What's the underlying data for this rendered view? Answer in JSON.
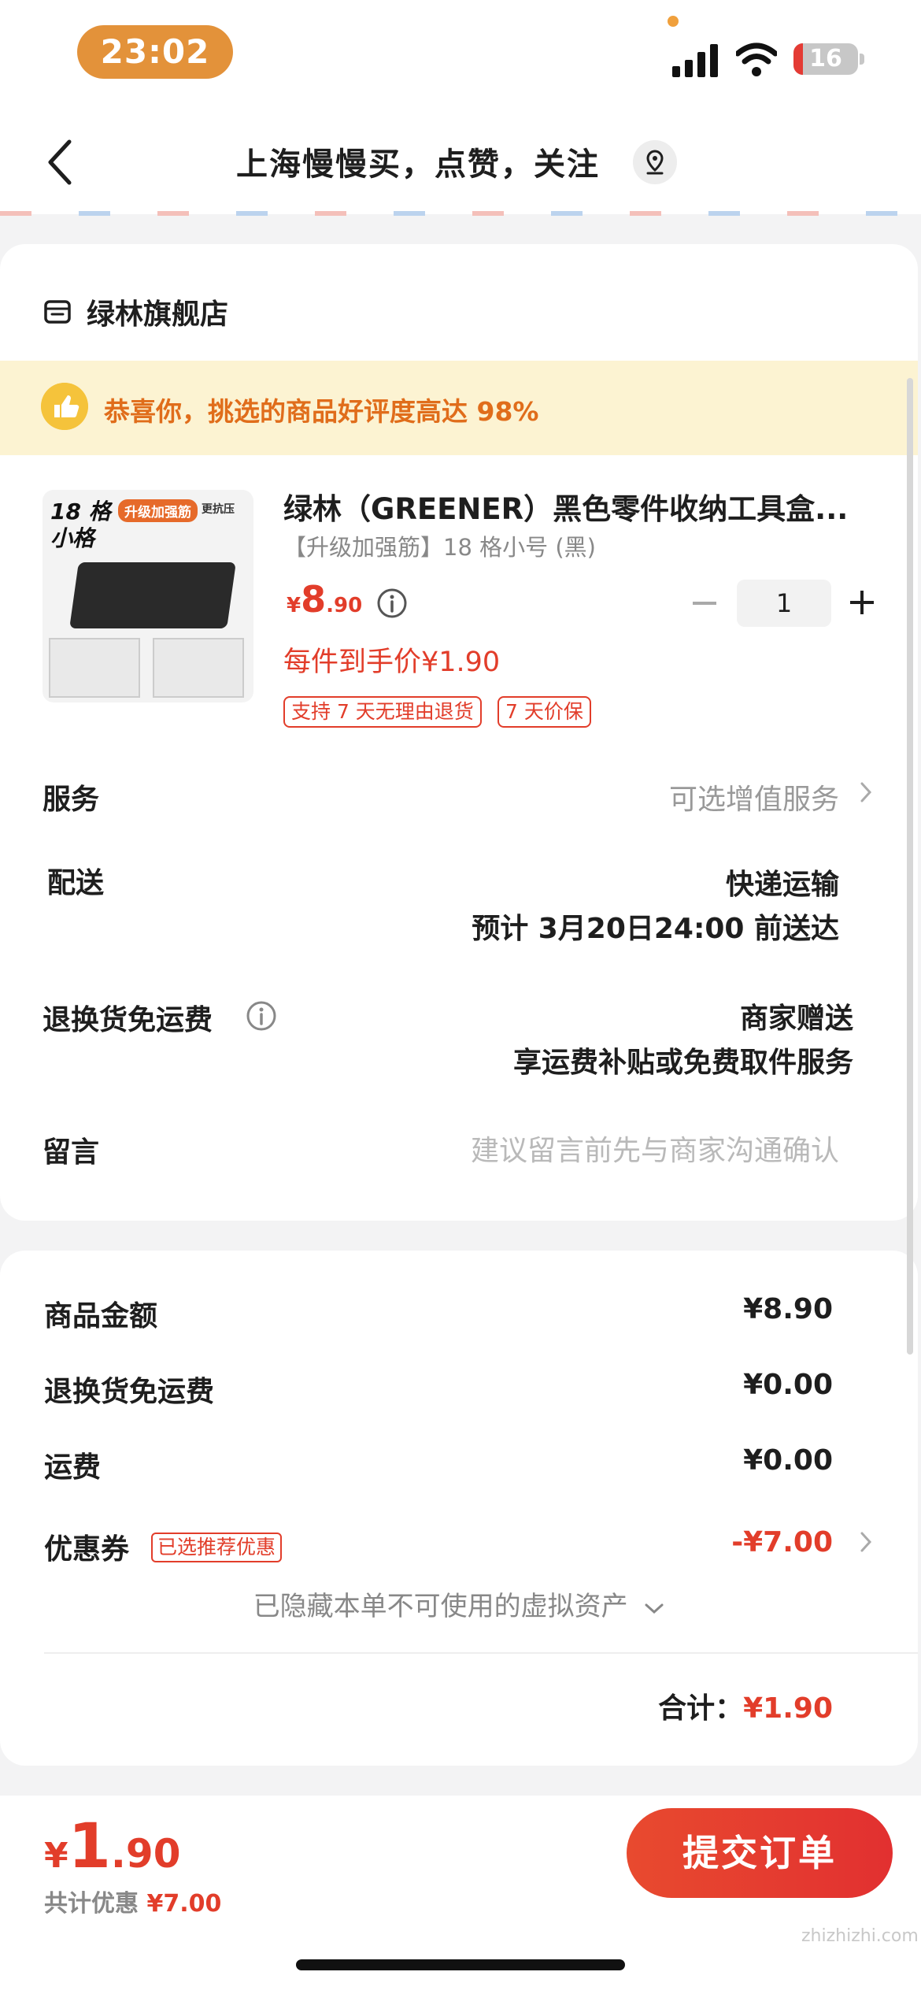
{
  "status_bar": {
    "time": "23:02",
    "battery": "16"
  },
  "nav": {
    "title": "上海慢慢买，点赞，关注"
  },
  "shop": {
    "name": "绿林旗舰店"
  },
  "banner": {
    "text": "恭喜你，挑选的商品好评度高达 98%"
  },
  "product": {
    "image_tags": [
      "18 格",
      "小格",
      "升级加强筋",
      "更抗压"
    ],
    "title": "绿林（GREENER）黑色零件收纳工具盒...",
    "spec": "【升级加强筋】18 格小号 (黑)",
    "price_currency": "¥",
    "price_int": "8",
    "price_dec": ".90",
    "quantity": "1",
    "hand_price": "每件到手价¥1.90",
    "badges": [
      "支持 7 天无理由退货",
      "7 天价保"
    ]
  },
  "rows": {
    "service_label": "服务",
    "service_value": "可选增值服务",
    "delivery_label": "配送",
    "delivery_value1": "快递运输",
    "delivery_value2": "预计 3月20日24:00 前送达",
    "return_label": "退换货免运费",
    "return_value1": "商家赠送",
    "return_value2": "享运费补贴或免费取件服务",
    "message_label": "留言",
    "message_placeholder": "建议留言前先与商家沟通确认"
  },
  "summary": {
    "goods_label": "商品金额",
    "goods_value": "¥8.90",
    "return_label": "退换货免运费",
    "return_value": "¥0.00",
    "shipping_label": "运费",
    "shipping_value": "¥0.00",
    "coupon_label": "优惠券",
    "coupon_tag": "已选推荐优惠",
    "coupon_value": "-¥7.00",
    "hidden_assets": "已隐藏本单不可使用的虚拟资产",
    "total_label": "合计：",
    "total_value": "¥1.90"
  },
  "bottom": {
    "currency": "¥",
    "price_int": "1",
    "price_dec": ".90",
    "discount_label": "共计优惠",
    "discount_value": "¥7.00",
    "submit_label": "提交订单"
  },
  "watermark": "zhizhizhi.com",
  "colors": {
    "accent": "#e23d2a",
    "banner_bg": "#fcf3d2",
    "banner_text": "#e06d1b",
    "time_pill": "#e3923a"
  }
}
